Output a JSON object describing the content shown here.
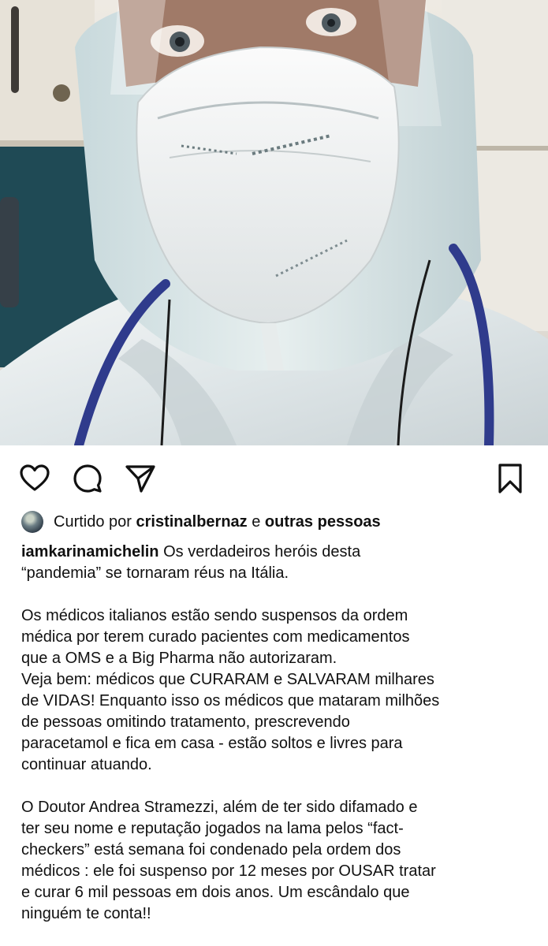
{
  "post": {
    "image_description_icon": "photo",
    "likes": {
      "prefix": "Curtido por",
      "user": "cristinalbernaz",
      "connector": "e",
      "others": "outras pessoas"
    },
    "caption": {
      "username": "iamkarinamichelin",
      "first_line_rest": "Os verdadeiros heróis desta",
      "lines": [
        "“pandemia” se tornaram réus na Itália.",
        "",
        "Os médicos italianos estão sendo suspensos da ordem",
        "médica por terem curado pacientes com medicamentos",
        "que a OMS e a Big Pharma não autorizaram.",
        "Veja bem: médicos que CURARAM e SALVARAM milhares",
        "de VIDAS! Enquanto isso os médicos que mataram milhões",
        "de pessoas omitindo tratamento, prescrevendo",
        "paracetamol e fica em casa - estão soltos e livres para",
        "continuar atuando.",
        "",
        "O Doutor Andrea Stramezzi, além de ter sido difamado e",
        "ter seu nome e reputação jogados na lama pelos “fact-",
        "checkers” está semana foi condenado pela ordem dos",
        "médicos : ele foi suspenso por 12 meses por OUSAR  tratar",
        "e curar 6 mil pessoas em dois anos. Um escândalo que",
        "ninguém te conta!!"
      ]
    }
  },
  "icons": {
    "like": "heart-icon",
    "comment": "comment-icon",
    "share": "paper-plane-icon",
    "save": "bookmark-icon"
  },
  "colors": {
    "text": "#111111",
    "background": "#ffffff"
  }
}
